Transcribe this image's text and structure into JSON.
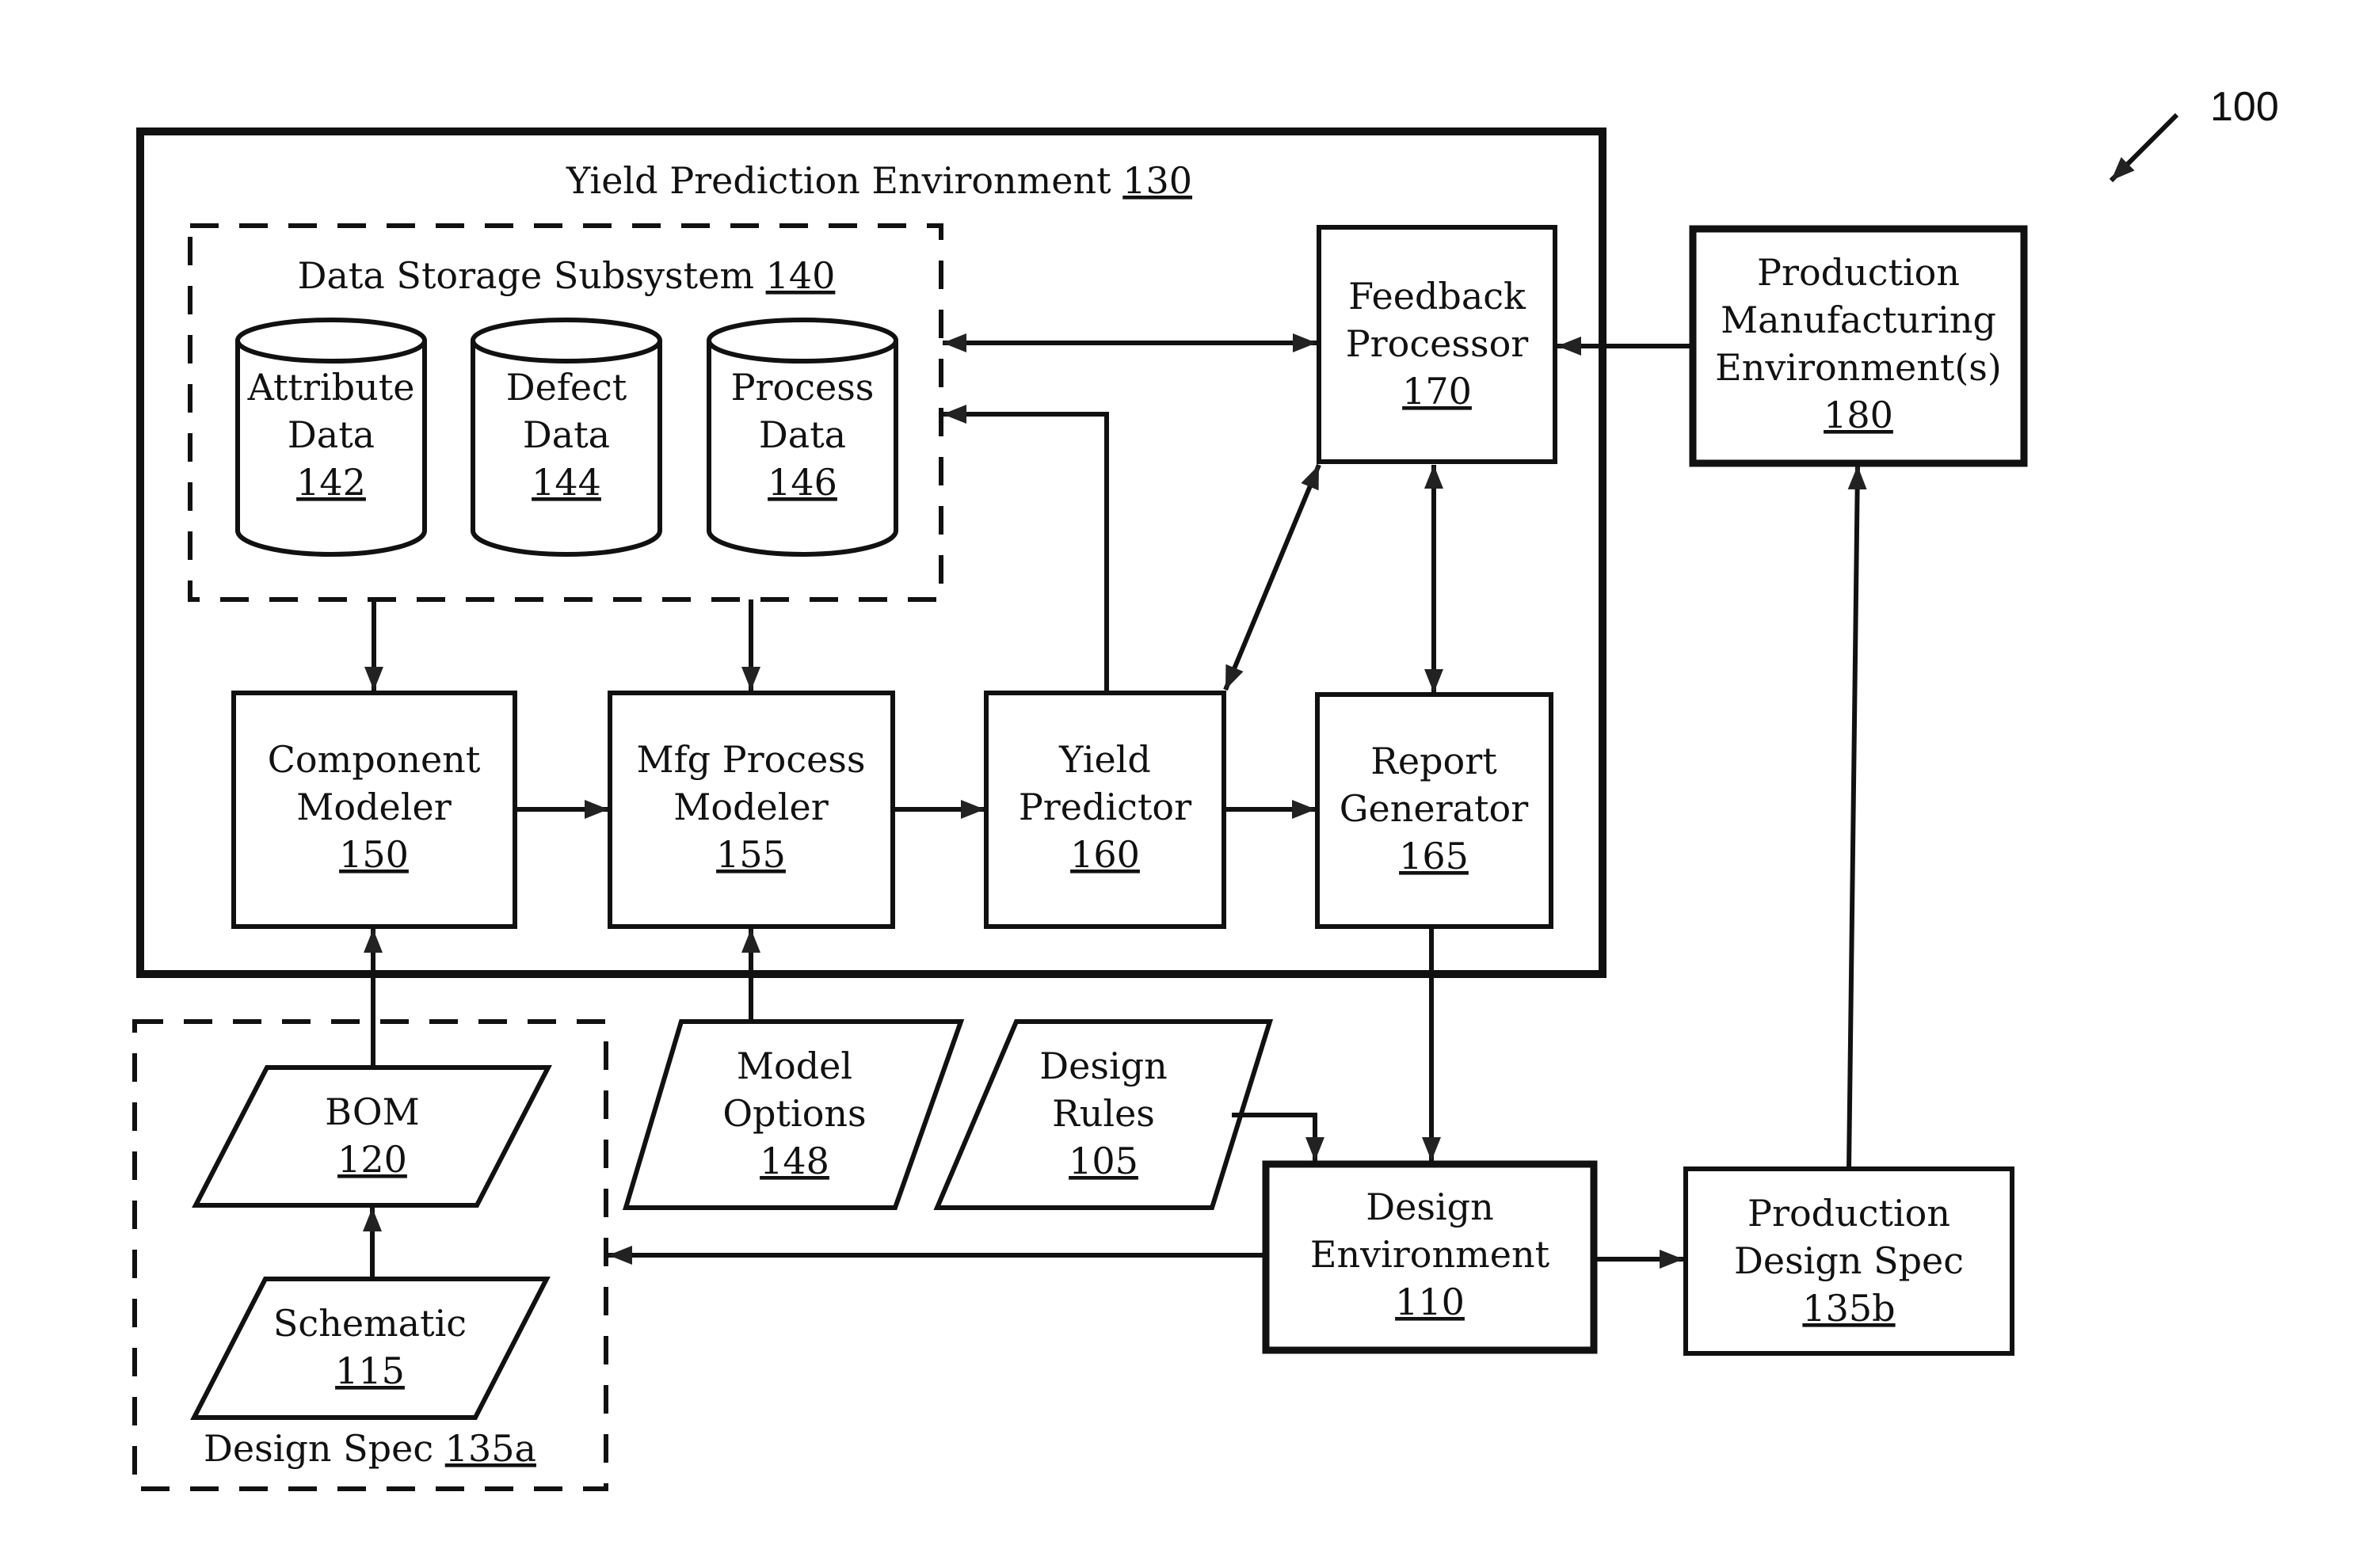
{
  "figure_ref": "100",
  "containers": {
    "yield_env": {
      "label": "Yield Prediction Environment",
      "num": "130"
    },
    "data_storage": {
      "label": "Data Storage Subsystem",
      "num": "140"
    },
    "design_spec_a": {
      "label": "Design Spec",
      "num": "135a"
    }
  },
  "databases": [
    {
      "line1": "Attribute",
      "line2": "Data",
      "num": "142"
    },
    {
      "line1": "Defect",
      "line2": "Data",
      "num": "144"
    },
    {
      "line1": "Process",
      "line2": "Data",
      "num": "146"
    }
  ],
  "blocks": {
    "feedback": {
      "line1": "Feedback",
      "line2": "Processor",
      "num": "170"
    },
    "prod_mfg": {
      "line1": "Production",
      "line2": "Manufacturing",
      "line3": "Environment(s)",
      "num": "180"
    },
    "component": {
      "line1": "Component",
      "line2": "Modeler",
      "num": "150"
    },
    "mfg_process": {
      "line1": "Mfg Process",
      "line2": "Modeler",
      "num": "155"
    },
    "yield_predictor": {
      "line1": "Yield",
      "line2": "Predictor",
      "num": "160"
    },
    "report": {
      "line1": "Report",
      "line2": "Generator",
      "num": "165"
    },
    "design_env": {
      "line1": "Design",
      "line2": "Environment",
      "num": "110"
    },
    "prod_spec": {
      "line1": "Production",
      "line2": "Design Spec",
      "num": "135b"
    }
  },
  "inputs": {
    "bom": {
      "line1": "BOM",
      "num": "120"
    },
    "schematic": {
      "line1": "Schematic",
      "num": "115"
    },
    "model_options": {
      "line1": "Model",
      "line2": "Options",
      "num": "148"
    },
    "design_rules": {
      "line1": "Design",
      "line2": "Rules",
      "num": "105"
    }
  }
}
